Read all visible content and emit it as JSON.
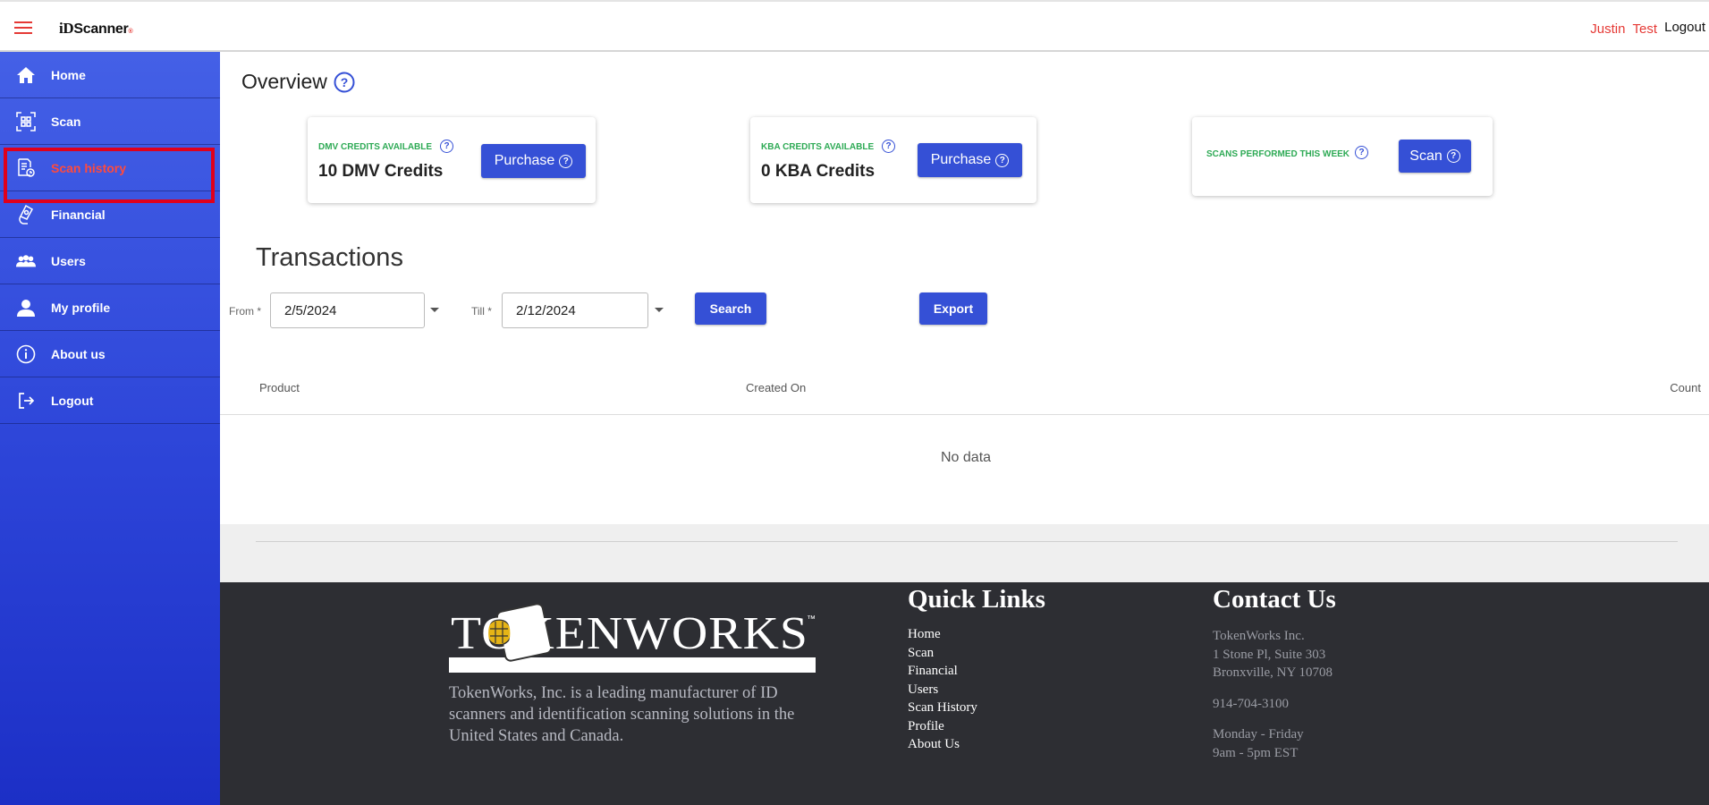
{
  "header": {
    "logo_id": "iD",
    "logo_text": "Scanner",
    "logo_mark": "®",
    "user_name": "Justin  Test",
    "logout_label": "Logout"
  },
  "sidebar": {
    "items": [
      {
        "label": "Home",
        "icon": "home-icon"
      },
      {
        "label": "Scan",
        "icon": "qr-scan-icon"
      },
      {
        "label": "Scan history",
        "icon": "document-history-icon",
        "active": true
      },
      {
        "label": "Financial",
        "icon": "money-hand-icon"
      },
      {
        "label": "Users",
        "icon": "users-icon"
      },
      {
        "label": "My profile",
        "icon": "person-icon"
      },
      {
        "label": "About us",
        "icon": "info-icon"
      },
      {
        "label": "Logout",
        "icon": "logout-icon"
      }
    ]
  },
  "overview": {
    "title": "Overview",
    "cards": [
      {
        "caption": "DMV CREDITS AVAILABLE",
        "value": "10 DMV Credits",
        "button": "Purchase"
      },
      {
        "caption": "KBA CREDITS AVAILABLE",
        "value": "0 KBA Credits",
        "button": "Purchase"
      },
      {
        "caption": "SCANS PERFORMED THIS WEEK",
        "value": "",
        "button": "Scan"
      }
    ]
  },
  "transactions": {
    "title": "Transactions",
    "from_label": "From *",
    "from_value": "2/5/2024",
    "till_label": "Till *",
    "till_value": "2/12/2024",
    "search_label": "Search",
    "export_label": "Export",
    "columns": [
      "Product",
      "Created On",
      "Count"
    ],
    "empty_text": "No data"
  },
  "footer": {
    "logo_text": "TOKENWORKS",
    "tm": "™",
    "description": "TokenWorks, Inc. is a leading manufacturer of ID scanners and identification scanning solutions in the United States and Canada.",
    "quick_links_title": "Quick Links",
    "quick_links": [
      "Home",
      "Scan",
      "Financial",
      "Users",
      "Scan History",
      "Profile",
      "About Us"
    ],
    "contact_title": "Contact Us",
    "contact": {
      "company": "TokenWorks Inc.",
      "address1": "1 Stone Pl, Suite 303",
      "address2": "Bronxville, NY 10708",
      "phone": "914-704-3100",
      "days": "Monday - Friday",
      "hours": "9am - 5pm EST"
    }
  },
  "colors": {
    "accent": "#3550d6",
    "sidebar_top": "#4460e6",
    "sidebar_bottom": "#1c2fc6",
    "active_red": "#e0001b",
    "caption_green": "#2eaa55",
    "footer_bg": "#2d2e33"
  }
}
